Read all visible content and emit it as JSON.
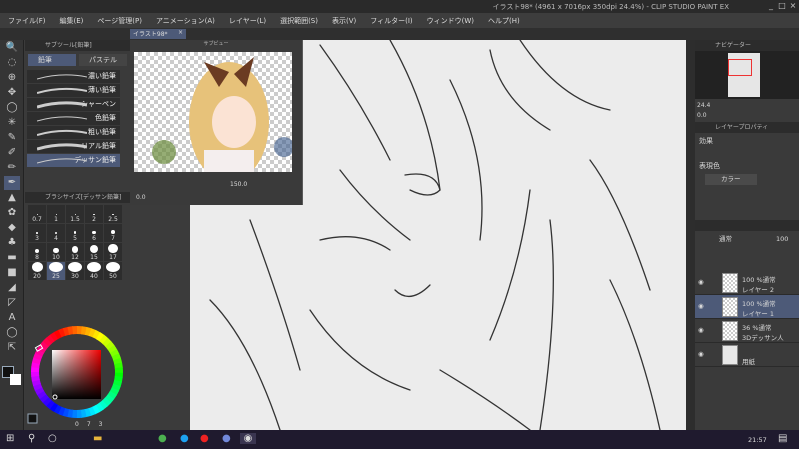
{
  "window": {
    "title": "イラスト98* (4961 x 7016px 350dpi 24.4%) - CLIP STUDIO PAINT EX",
    "minimize": "_",
    "maximize": "□",
    "close": "×"
  },
  "menu": [
    "ファイル(F)",
    "編集(E)",
    "ページ管理(P)",
    "アニメーション(A)",
    "レイヤー(L)",
    "選択範囲(S)",
    "表示(V)",
    "フィルター(I)",
    "ウィンドウ(W)",
    "ヘルプ(H)"
  ],
  "doc_tab": {
    "label": "イラスト98*",
    "close": "×"
  },
  "tools": [
    "🔍",
    "◌",
    "⊕",
    "✥",
    "◯",
    "✳",
    "✎",
    "✐",
    "✏",
    "✒",
    "▲",
    "✿",
    "◆",
    "♣",
    "▬",
    "■",
    "◢",
    "◸",
    "A",
    "◯",
    "⇱"
  ],
  "subtool": {
    "title": "サブツール[鉛筆]",
    "tabs": [
      "鉛筆",
      "パステル"
    ],
    "brushes": [
      "濃い鉛筆",
      "薄い鉛筆",
      "シャーペン",
      "色鉛筆",
      "粗い鉛筆",
      "リアル鉛筆",
      "デッサン鉛筆"
    ],
    "selected": 6
  },
  "brush_size": {
    "title": "ブラシサイズ[デッサン鉛筆]",
    "sizes": [
      "0.7",
      "1",
      "1.5",
      "2",
      "2.5",
      "3",
      "4",
      "5",
      "6",
      "7",
      "8",
      "10",
      "12",
      "15",
      "17",
      "20",
      "25",
      "30",
      "40",
      "50"
    ],
    "selected": "25"
  },
  "preview": {
    "title": "サブビュー",
    "zoom": "150.0",
    "rotate": "0.0"
  },
  "color": {
    "main": "#111111",
    "sub": "#ffffff",
    "readout": [
      "0",
      "7",
      "3"
    ]
  },
  "navigator": {
    "title": "ナビゲーター",
    "zoom": "24.4",
    "rotate": "0.0"
  },
  "layer_property": {
    "title": "レイヤープロパティ",
    "effect_label": "効果",
    "color_label": "表現色",
    "color_value": "カラー"
  },
  "layers": {
    "blend": "通常",
    "opacity": "100",
    "items": [
      {
        "info": "100 %通常",
        "name": "レイヤー 2",
        "selected": false
      },
      {
        "info": "100 %通常",
        "name": "レイヤー 1",
        "selected": true
      },
      {
        "info": "36 %通常",
        "name": "3Dデッサン人",
        "selected": false
      },
      {
        "info": "",
        "name": "用紙",
        "selected": false
      }
    ]
  },
  "taskbar": {
    "clock": "21:57"
  },
  "accent": "#4d5a78"
}
